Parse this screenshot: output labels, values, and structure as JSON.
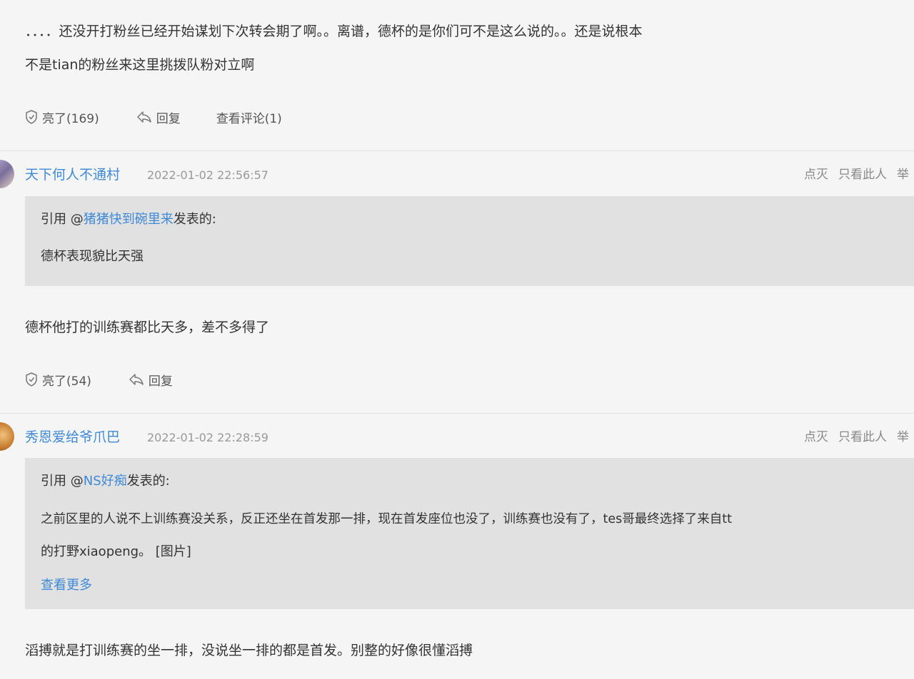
{
  "comment_top": {
    "text_line1": "．．．．还没开打粉丝已经开始谋划下次转会期了啊。。离谱，德杯的是你们可不是这么说的。。还是说根本",
    "text_line2": "不是tian的粉丝来这里挑拨队粉对立啊",
    "like_label": "亮了(169)",
    "reply_label": "回复",
    "view_comments_label": "查看评论(1)"
  },
  "post1": {
    "username": "天下何人不通村",
    "time": "2022-01-02 22:56:57",
    "ops": [
      "点灭",
      "只看此人",
      "举"
    ],
    "quote_prefix": "引用 @",
    "quote_user": "猪猪快到碗里来",
    "quote_suffix": "发表的:",
    "quote_text": "德杯表现貌比天强",
    "body": "德杯他打的训练赛都比天多，差不多得了",
    "like_label": "亮了(54)",
    "reply_label": "回复"
  },
  "post2": {
    "username": "秀恩爱给爷爪巴",
    "time": "2022-01-02 22:28:59",
    "ops": [
      "点灭",
      "只看此人",
      "举"
    ],
    "quote_prefix": "引用 @",
    "quote_user": "NS好痴",
    "quote_suffix": "发表的:",
    "quote_text_line1": "之前区里的人说不上训练赛没关系，反正还坐在首发那一排，现在首发座位也没了，训练赛也没有了，tes哥最终选择了来自tt",
    "quote_text_line2": "的打野xiaopeng。 [图片]",
    "view_more_label": "查看更多",
    "body": "滔搏就是打训练赛的坐一排，没说坐一排的都是首发。别整的好像很懂滔搏"
  },
  "colors": {
    "link": "#3e89d6",
    "quote_bg": "#e1e1e1",
    "page_bg": "#f5f5f5"
  }
}
